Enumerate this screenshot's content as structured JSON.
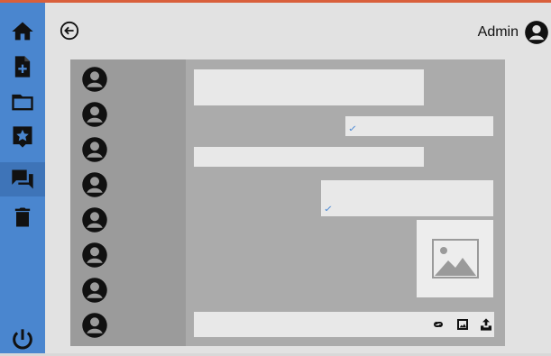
{
  "header": {
    "user_name": "Admin"
  },
  "sidebar": {
    "items": [
      {
        "name": "home",
        "icon": "home-icon"
      },
      {
        "name": "new-file",
        "icon": "file-plus-icon"
      },
      {
        "name": "folder",
        "icon": "folder-icon"
      },
      {
        "name": "flagged",
        "icon": "bookmark-star-icon"
      },
      {
        "name": "chat",
        "icon": "chat-icon",
        "active": true
      },
      {
        "name": "trash",
        "icon": "trash-icon"
      },
      {
        "name": "logout",
        "icon": "power-icon"
      }
    ]
  },
  "chat": {
    "composer": {
      "placeholder": "",
      "icons": [
        "link-icon",
        "image-icon",
        "upload-icon"
      ]
    },
    "contacts_count_label": "",
    "colors": {
      "sidebar": "#4a86cf",
      "accent_tick": "#5a92d6"
    }
  }
}
